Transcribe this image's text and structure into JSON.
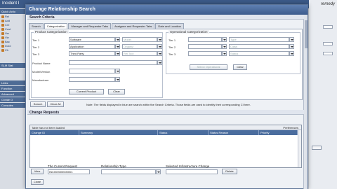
{
  "background": {
    "window_title": "Incident I",
    "brand": "remedy",
    "sidebar": {
      "sections": [
        "Quick Actio",
        "SLM Stat",
        "Links",
        "Function",
        "Advanced",
        "Create O",
        "Consoles"
      ],
      "items": [
        "Rel",
        "Add",
        "Cre",
        "Cust",
        "Ver",
        "Vie",
        "Bac",
        "Incid",
        "Ch"
      ]
    }
  },
  "dialog": {
    "title": "Change Relationship Search",
    "search_criteria_label": "Search Criteria",
    "tabs": [
      {
        "label": "Search",
        "active": false
      },
      {
        "label": "Categorization",
        "active": true
      },
      {
        "label": "Manager and Requester Tabs",
        "active": false
      },
      {
        "label": "Assignee and Requester Tabs",
        "active": false
      },
      {
        "label": "Date and Location",
        "active": false
      }
    ],
    "product_categorization": {
      "title": "Product Categorization",
      "rows": [
        {
          "label": "Tier 1",
          "value": "Software",
          "extra": "Model"
        },
        {
          "label": "Tier 2",
          "value": "Application",
          "extra": "Organiz"
        },
        {
          "label": "Tier 3",
          "value": "Third Party",
          "extra": "Rel Tool"
        }
      ],
      "product_name_label": "Product Name",
      "model_version_label": "Model/Version",
      "manufacturer_label": "Manufacturer",
      "current_product_button": "Current Product",
      "clear_button": "Clear"
    },
    "operational_categorization": {
      "title": "Operational Categorization",
      "rows": [
        {
          "label": "Tier 1",
          "extra": "Type"
        },
        {
          "label": "Tier 2",
          "extra": "Class"
        },
        {
          "label": "Tier 3",
          "extra": "Status"
        }
      ],
      "search_button": "Select Operational",
      "clear_button": "Clear"
    },
    "search_button": "Search",
    "clear_all_button": "Clear All",
    "note": "Note: The fields displayed in blue are search within the Search Criteria. Those fields are used to identify their corresponding CI here.",
    "change_requests": {
      "title": "Change Requests",
      "table_info": "Table has not been loaded",
      "preferences": "Preferences",
      "columns": [
        "Change ID",
        "Summary",
        "Status",
        "Status Reason",
        "Priority"
      ]
    },
    "view_button": "View",
    "current_request_label": "The Current Request",
    "current_request_value": "INC000000000001",
    "relationship_type_label": "Relationship Type",
    "selected_change_label": "Selected Infrastructure Change",
    "relate_button": "Relate",
    "close_button": "Close"
  }
}
